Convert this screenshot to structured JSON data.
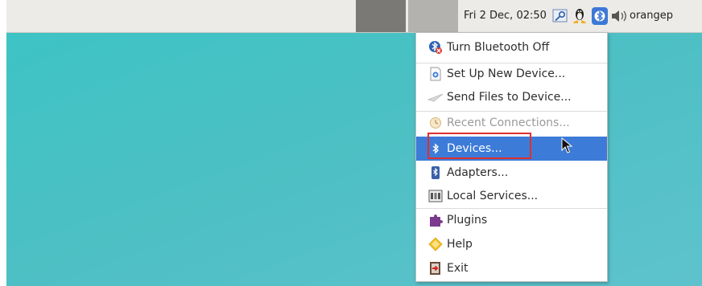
{
  "panel": {
    "clock": "Fri  2 Dec, 02:50",
    "username": "orangep",
    "tray_icons": [
      "key-icon",
      "tux-icon",
      "bluetooth-icon",
      "volume-icon"
    ]
  },
  "bluetooth_menu": {
    "items": [
      {
        "label": "Turn Bluetooth Off",
        "icon": "bluetooth-off-icon",
        "state": "normal"
      },
      {
        "label": "Set Up New Device...",
        "icon": "new-device-icon",
        "state": "normal"
      },
      {
        "label": "Send Files to Device...",
        "icon": "send-files-icon",
        "state": "normal"
      },
      {
        "label": "Recent Connections...",
        "icon": "clock-icon",
        "state": "disabled"
      },
      {
        "label": "Devices...",
        "icon": "bluetooth-icon",
        "state": "active"
      },
      {
        "label": "Adapters...",
        "icon": "adapter-icon",
        "state": "normal"
      },
      {
        "label": "Local Services...",
        "icon": "services-icon",
        "state": "normal"
      },
      {
        "label": "Plugins",
        "icon": "puzzle-icon",
        "state": "normal"
      },
      {
        "label": "Help",
        "icon": "help-icon",
        "state": "normal"
      },
      {
        "label": "Exit",
        "icon": "exit-icon",
        "state": "normal"
      }
    ]
  },
  "colors": {
    "desktop": "#4cc0c4",
    "highlight": "#3d7bd8",
    "annotation_box": "#e0302d"
  }
}
